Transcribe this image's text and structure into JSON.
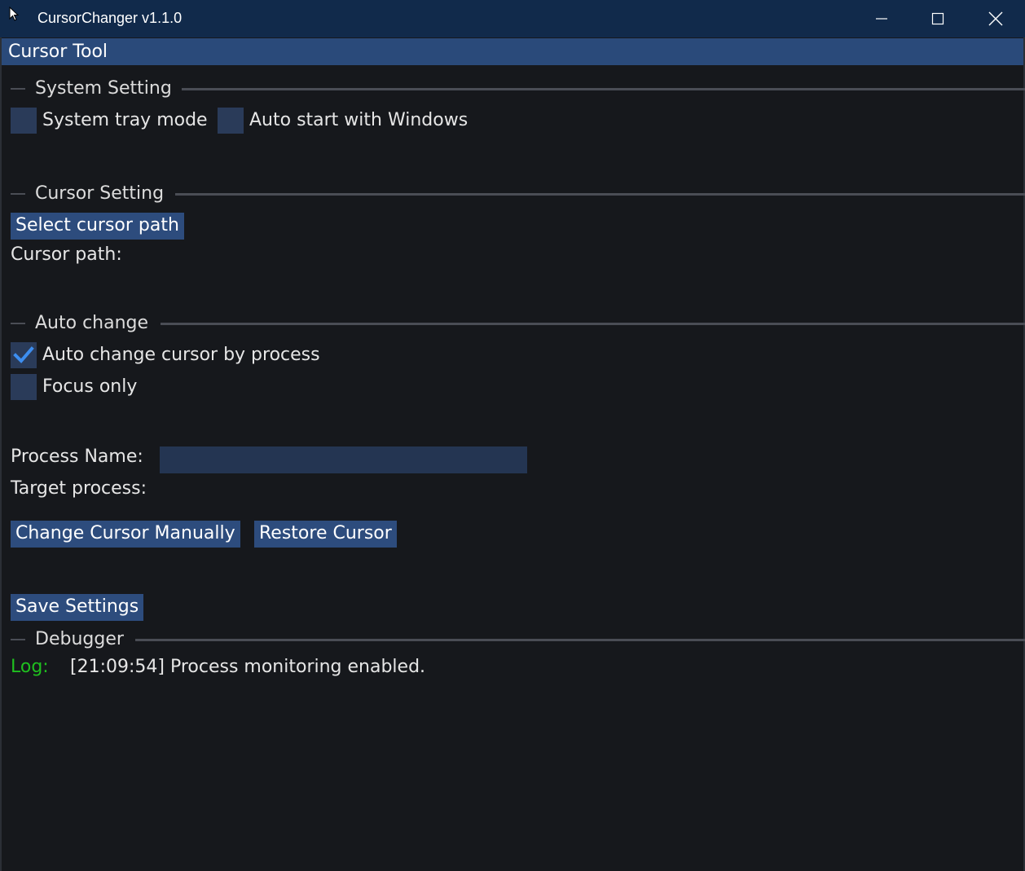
{
  "window": {
    "title": "CursorChanger v1.1.0",
    "app_icon": "cursor-arrow-icon",
    "controls": [
      "minimize-icon",
      "maximize-icon",
      "close-icon"
    ]
  },
  "menubar": {
    "title": "Cursor Tool"
  },
  "system_setting": {
    "header": "System Setting",
    "tray_mode": {
      "label": "System tray mode",
      "checked": false
    },
    "auto_start": {
      "label": "Auto start with Windows",
      "checked": false
    }
  },
  "cursor_setting": {
    "header": "Cursor Setting",
    "select_button": "Select cursor path",
    "path_label": "Cursor path:"
  },
  "auto_change": {
    "header": "Auto change",
    "by_process": {
      "label": "Auto change cursor by process",
      "checked": true
    },
    "focus_only": {
      "label": "Focus only",
      "checked": false
    },
    "process_name_label": "Process Name:",
    "process_name_value": "",
    "target_process_label": "Target process:",
    "change_button": "Change Cursor Manually",
    "restore_button": "Restore Cursor"
  },
  "save_button": "Save Settings",
  "debugger": {
    "header": "Debugger",
    "log_label": "Log:",
    "log_text": "[21:09:54] Process monitoring enabled."
  },
  "colors": {
    "titlebar": "#112a4b",
    "accent": "#2d4c7d",
    "background": "#16181c",
    "checkmark": "#3d8ef0",
    "log_label": "#1fbf1f"
  }
}
